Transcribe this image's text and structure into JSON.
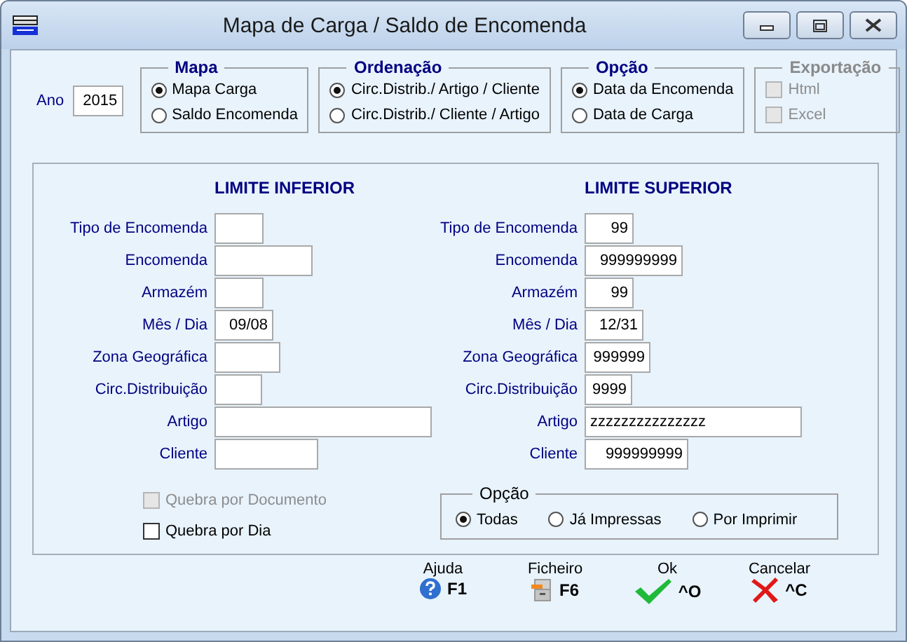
{
  "window": {
    "title": "Mapa de Carga / Saldo de Encomenda"
  },
  "year": {
    "label": "Ano",
    "value": "2015"
  },
  "groups": [
    {
      "title": "Mapa",
      "kind": "radio",
      "disabled": false,
      "options": [
        {
          "label": "Mapa Carga",
          "selected": true
        },
        {
          "label": "Saldo Encomenda",
          "selected": false
        }
      ]
    },
    {
      "title": "Ordenação",
      "kind": "radio",
      "disabled": false,
      "options": [
        {
          "label": "Circ.Distrib./ Artigo / Cliente",
          "selected": true
        },
        {
          "label": "Circ.Distrib./ Cliente / Artigo",
          "selected": false
        }
      ]
    },
    {
      "title": "Opção",
      "kind": "radio",
      "disabled": false,
      "options": [
        {
          "label": "Data da Encomenda",
          "selected": true
        },
        {
          "label": "Data de Carga",
          "selected": false
        }
      ]
    },
    {
      "title": "Exportação",
      "kind": "checkbox",
      "disabled": true,
      "options": [
        {
          "label": "Html",
          "checked": false
        },
        {
          "label": "Excel",
          "checked": false
        }
      ]
    }
  ],
  "lower": {
    "title": "LIMITE INFERIOR",
    "fields": [
      {
        "label": "Tipo de Encomenda"
      },
      {
        "label": "Encomenda"
      },
      {
        "label": "Armazém"
      },
      {
        "label": "Mês / Dia",
        "value": "09/08"
      },
      {
        "label": "Zona Geográfica"
      },
      {
        "label": "Circ.Distribuição"
      },
      {
        "label": "Artigo"
      },
      {
        "label": "Cliente"
      }
    ]
  },
  "upper": {
    "title": "LIMITE SUPERIOR",
    "fields": [
      {
        "label": "Tipo de Encomenda",
        "value": "99"
      },
      {
        "label": "Encomenda",
        "value": "999999999"
      },
      {
        "label": "Armazém",
        "value": "99"
      },
      {
        "label": "Mês / Dia",
        "value": "12/31"
      },
      {
        "label": "Zona Geográfica",
        "value": "999999"
      },
      {
        "label": "Circ.Distribuição",
        "value": "9999"
      },
      {
        "label": "Artigo",
        "value": "zzzzzzzzzzzzzzz"
      },
      {
        "label": "Cliente",
        "value": "999999999"
      }
    ]
  },
  "checkboxes": [
    {
      "label": "Quebra por Documento",
      "checked": false,
      "disabled": true
    },
    {
      "label": "Quebra por Dia",
      "checked": false,
      "disabled": false
    }
  ],
  "print_option": {
    "title": "Opção",
    "options": [
      {
        "label": "Todas",
        "selected": true
      },
      {
        "label": "Já Impressas",
        "selected": false
      },
      {
        "label": "Por Imprimir",
        "selected": false
      }
    ]
  },
  "buttons": [
    {
      "kind": "help",
      "label": "Ajuda",
      "shortcut": "F1"
    },
    {
      "kind": "file",
      "label": "Ficheiro",
      "shortcut": "F6"
    },
    {
      "kind": "ok",
      "label": "Ok",
      "shortcut": "^O"
    },
    {
      "kind": "cancel",
      "label": "Cancelar",
      "shortcut": "^C"
    }
  ]
}
